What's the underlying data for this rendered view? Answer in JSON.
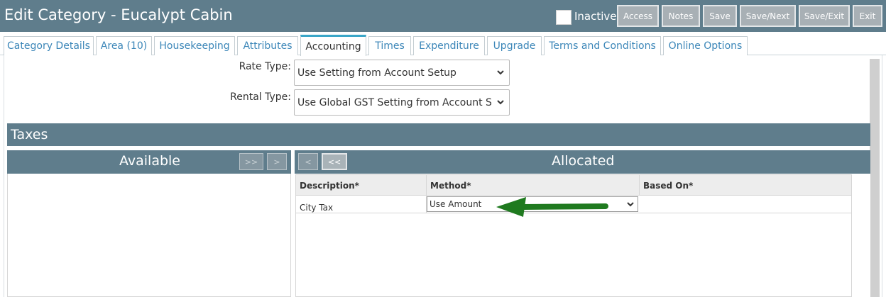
{
  "header": {
    "title": "Edit Category - Eucalypt Cabin",
    "inactive_label": "Inactive",
    "buttons": {
      "access": "Access",
      "notes": "Notes",
      "save": "Save",
      "save_next": "Save/Next",
      "save_exit": "Save/Exit",
      "exit": "Exit"
    }
  },
  "tabs": [
    {
      "label": "Category Details"
    },
    {
      "label": "Area (10)"
    },
    {
      "label": "Housekeeping"
    },
    {
      "label": "Attributes"
    },
    {
      "label": "Accounting",
      "active": true
    },
    {
      "label": "Times"
    },
    {
      "label": "Expenditure"
    },
    {
      "label": "Upgrade"
    },
    {
      "label": "Terms and Conditions"
    },
    {
      "label": "Online Options"
    }
  ],
  "form": {
    "rate_type": {
      "label": "Rate Type:",
      "value": "Use Setting from Account Setup"
    },
    "rental_type": {
      "label": "Rental Type:",
      "value": "Use Global GST Setting from Account Setup"
    }
  },
  "taxes": {
    "section_title": "Taxes",
    "available": {
      "title": "Available",
      "move_all_label": ">>",
      "move_one_label": ">"
    },
    "allocated": {
      "title": "Allocated",
      "remove_one_label": "<",
      "remove_all_label": "<<",
      "columns": {
        "description": "Description*",
        "method": "Method*",
        "based_on": "Based On*"
      },
      "rows": [
        {
          "description": "City Tax",
          "method": "Use Amount",
          "based_on": ""
        }
      ]
    }
  },
  "colors": {
    "header_bg": "#5f7d8c",
    "tab_link": "#3b86b8",
    "active_tab_accent": "#3aa6c8",
    "arrow": "#1f7a1f"
  }
}
